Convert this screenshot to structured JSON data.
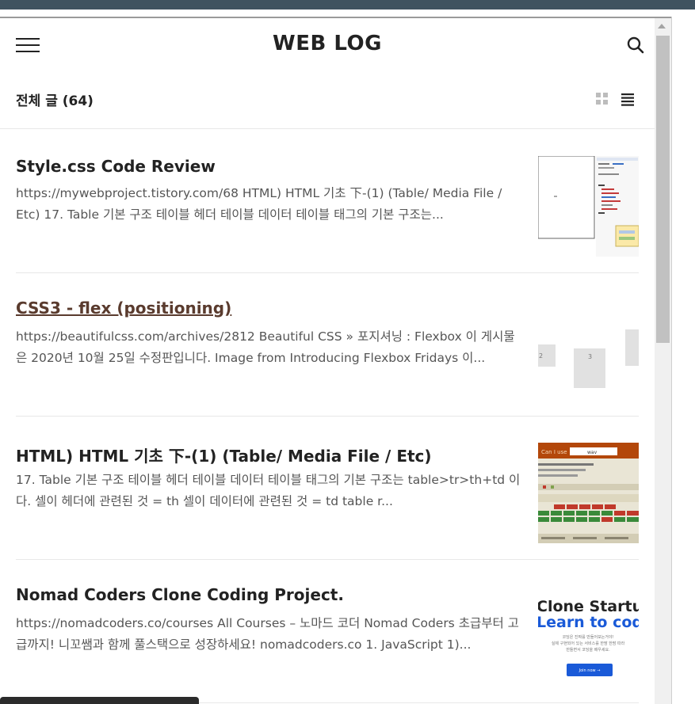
{
  "header": {
    "site_title": "WEB LOG",
    "menu_icon": "hamburger-menu-icon",
    "search_icon": "search-icon"
  },
  "listing": {
    "title": "전체 글 (64)",
    "view_modes": [
      "grid-view-icon",
      "list-view-icon"
    ]
  },
  "posts": [
    {
      "title": "Style.css Code Review",
      "excerpt": "https://mywebproject.tistory.com/68 HTML) HTML 기초 下-(1) (Table/ Media File / Etc) 17. Table 기본 구조 테이블 헤더 테이블 데이터 테이블 태그의 기본 구조는...",
      "visited": false
    },
    {
      "title": "CSS3 - flex (positioning)",
      "excerpt": "https://beautifulcss.com/archives/2812 Beautiful CSS » 포지셔닝 : Flexbox 이 게시물은 2020년 10월 25일 수정판입니다. Image from Introducing Flexbox Fridays 이...",
      "visited": true
    },
    {
      "title": "HTML) HTML 기초 下-(1) (Table/ Media File / Etc)",
      "excerpt": "17. Table 기본 구조 테이블 헤더 테이블 데이터 테이블 태그의 기본 구조는 table>tr>th+td 이다. 셀이 헤더에 관련된 것 = th 셀이 데이터에 관련된 것 = td table r...",
      "visited": false
    },
    {
      "title": "Nomad Coders Clone Coding Project.",
      "excerpt": "https://nomadcoders.co/courses All Courses – 노마드 코더 Nomad Coders 초급부터 고급까지! 니꼬쌤과 함께 풀스택으로 성장하세요! nomadcoders.co 1. JavaScript 1)...",
      "visited": false
    }
  ],
  "thumbs": {
    "caniuse_label": "Can I use",
    "caniuse_query": "wav",
    "flex_box_label": "3",
    "flex_box_label_left": "2",
    "nomad_line1": "Clone Startups",
    "nomad_line2": "Learn to code",
    "nomad_sub1": "코딩은 진짜를 만들어보는거야!",
    "nomad_sub2": "실제 구현되어 있는 서비스를 한땀 한땀 따라",
    "nomad_sub3": "만들면서 코딩을 배우세요.",
    "nomad_button": "Join now →"
  },
  "colors": {
    "topbar": "#3f5360",
    "visited_link": "#5a3b2e",
    "nomad_blue": "#1a5ad8"
  }
}
